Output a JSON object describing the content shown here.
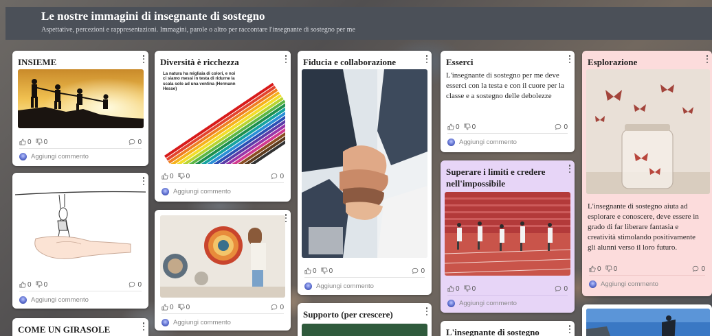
{
  "header": {
    "title": "Le nostre immagini di insegnante di sostegno",
    "subtitle": "Aspettative, percezioni e rappresentazioni. Immagini, parole o altro per raccontare l'insegnante di sostegno per me"
  },
  "common": {
    "likes": "0",
    "dislikes": "0",
    "comments": "0",
    "add_comment": "Aggiungi commento"
  },
  "cards": {
    "insieme": {
      "title": "INSIEME"
    },
    "hand": {
      "title": ""
    },
    "girasole": {
      "title": "COME UN GIRASOLE"
    },
    "diversita": {
      "title": "Diversità è ricchezza",
      "image_text": "La natura ha migliaia di colori, e noi ci siamo messi in testa di ridurne la scala solo ad una ventina (Hermann Hesse)"
    },
    "weaving": {
      "title": ""
    },
    "fiducia": {
      "title": "Fiducia e collaborazione"
    },
    "supporto": {
      "title": "Supporto (per crescere)"
    },
    "esserci": {
      "title": "Esserci",
      "body": "L'insegnante di sostegno per me deve esserci con la testa e con il cuore per la classe e a sostegno delle debolezze"
    },
    "superare": {
      "title": "Superare i limiti e credere nell'impossibile"
    },
    "insegnante": {
      "title": "L'insegnante di sostegno"
    },
    "esplorazione": {
      "title": "Esplorazione",
      "body": "L'insegnante di sostegno aiuta ad esplorare e conoscere, deve essere in grado di far liberare fantasia e creatività stimolando positivamente gli alunni verso il loro futuro."
    }
  },
  "colors": {
    "header_bg": "#4b5058",
    "card_white": "#ffffff",
    "card_purple": "#e7d5f7",
    "card_pink": "#fcdcdc"
  }
}
